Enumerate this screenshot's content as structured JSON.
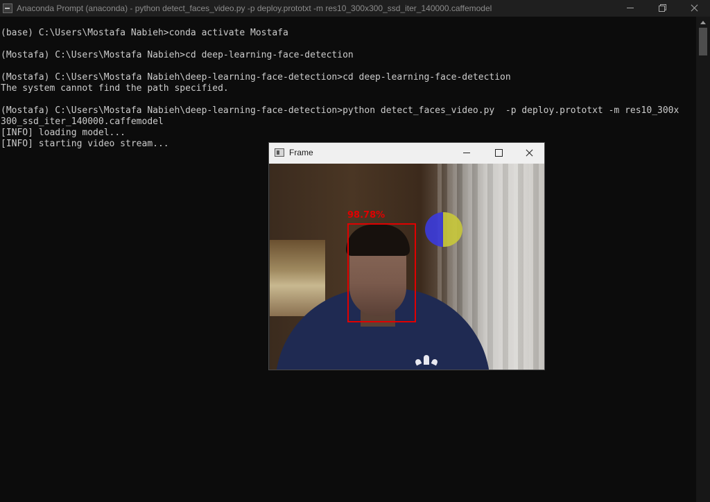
{
  "console_window": {
    "title": "Anaconda Prompt (anaconda) - python  detect_faces_video.py  -p deploy.prototxt -m res10_300x300_ssd_iter_140000.caffemodel",
    "lines": [
      "(base) C:\\Users\\Mostafa Nabieh>conda activate Mostafa",
      "",
      "(Mostafa) C:\\Users\\Mostafa Nabieh>cd deep-learning-face-detection",
      "",
      "(Mostafa) C:\\Users\\Mostafa Nabieh\\deep-learning-face-detection>cd deep-learning-face-detection",
      "The system cannot find the path specified.",
      "",
      "(Mostafa) C:\\Users\\Mostafa Nabieh\\deep-learning-face-detection>python detect_faces_video.py  -p deploy.prototxt -m res10_300x",
      "300_ssd_iter_140000.caffemodel",
      "[INFO] loading model...",
      "[INFO] starting video stream..."
    ]
  },
  "frame_window": {
    "title": "Frame",
    "detection_label": "98.78%"
  },
  "colors": {
    "console_bg": "#0c0c0c",
    "console_text": "#cccccc",
    "detection": "#e00000"
  }
}
